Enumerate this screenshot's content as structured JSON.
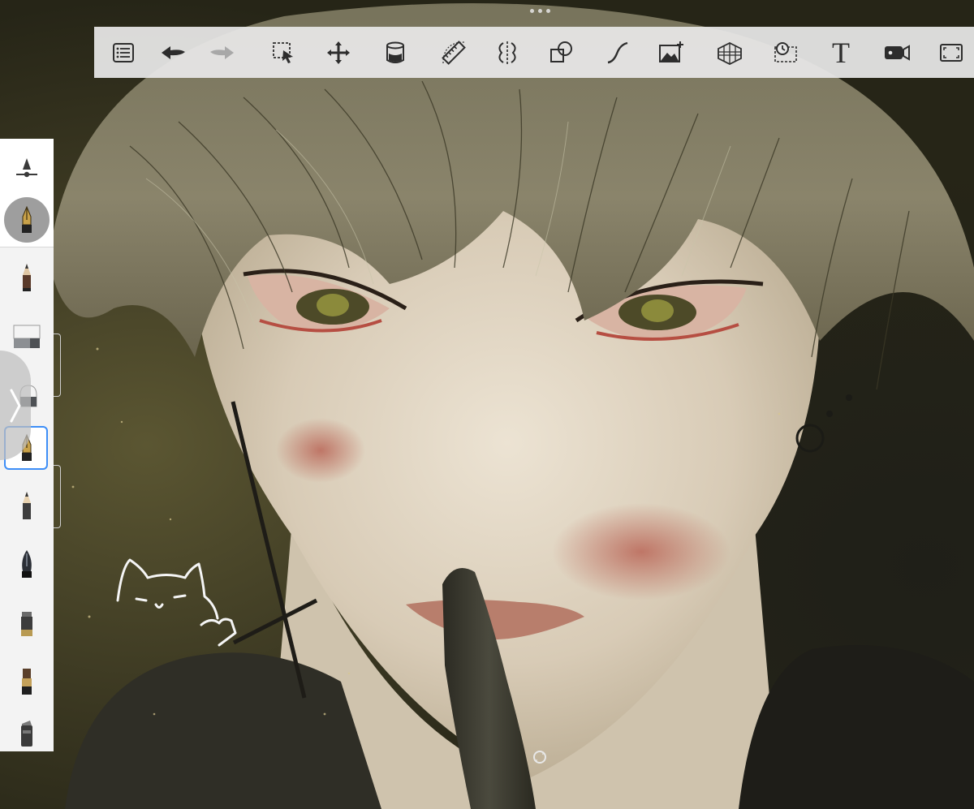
{
  "app": {
    "window_dots": "•••"
  },
  "toolbar": {
    "items": [
      {
        "name": "layers-list",
        "icon": "list-icon"
      },
      {
        "name": "undo",
        "icon": "undo-arrow-icon"
      },
      {
        "name": "redo",
        "icon": "redo-arrow-icon"
      },
      {
        "name": "selection",
        "icon": "selection-arrow-icon"
      },
      {
        "name": "transform",
        "icon": "move-arrows-icon"
      },
      {
        "name": "fill",
        "icon": "fill-bucket-icon"
      },
      {
        "name": "ruler",
        "icon": "ruler-icon"
      },
      {
        "name": "symmetry",
        "icon": "symmetry-icon"
      },
      {
        "name": "shapes",
        "icon": "shapes-icon"
      },
      {
        "name": "curve",
        "icon": "curve-icon"
      },
      {
        "name": "import-image",
        "icon": "add-image-icon"
      },
      {
        "name": "perspective",
        "icon": "perspective-grid-icon"
      },
      {
        "name": "time-lapse",
        "icon": "timelapse-icon"
      },
      {
        "name": "text",
        "icon": "text-T-icon",
        "label": "T"
      },
      {
        "name": "record",
        "icon": "video-camera-icon"
      },
      {
        "name": "fullscreen",
        "icon": "fullscreen-icon"
      }
    ]
  },
  "brush_panel": {
    "collapse_label": "〉",
    "slots": [
      {
        "name": "brush-size-opacity",
        "icon": "cone-slider-icon"
      },
      {
        "name": "active-brush",
        "icon": "ink-pen-nib-icon",
        "active": true
      },
      {
        "name": "pencil",
        "icon": "pencil-icon"
      },
      {
        "name": "eraser",
        "icon": "eraser-icon"
      },
      {
        "name": "soft-eraser",
        "icon": "eraser-round-icon"
      },
      {
        "name": "ink-pen",
        "icon": "ink-pen-nib-icon",
        "selected": true
      },
      {
        "name": "hard-pencil",
        "icon": "pencil-icon"
      },
      {
        "name": "fountain-pen",
        "icon": "fountain-nib-icon"
      },
      {
        "name": "marker",
        "icon": "marker-icon"
      },
      {
        "name": "paint-brush",
        "icon": "paint-brush-icon"
      },
      {
        "name": "chisel-marker",
        "icon": "chisel-marker-icon"
      }
    ]
  },
  "colors": {
    "toolbar_bg": "#e8e8e8",
    "icon": "#2d2d2d",
    "icon_disabled": "#a8a8a8",
    "selection_accent": "#3d8ef7",
    "canvas_dark": "#2a2a1c"
  }
}
